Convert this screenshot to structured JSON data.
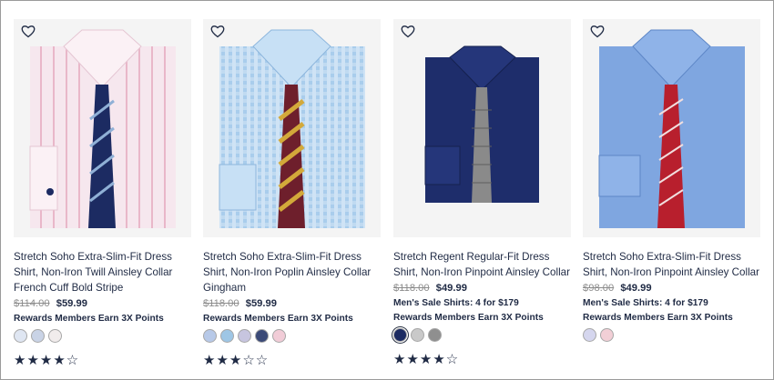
{
  "products": [
    {
      "title": "Stretch Soho Extra-Slim-Fit Dress Shirt, Non-Iron Twill Ainsley Collar French Cuff Bold Stripe",
      "original_price": "$114.00",
      "sale_price": "$59.99",
      "promo": "",
      "rewards": "Rewards Members Earn 3X Points",
      "swatches": [
        "#dfe6f2",
        "#c9d3e6",
        "#f1ecec"
      ],
      "rating_text": "★★★★☆",
      "shirt_color": "#f6e7ee",
      "stripe_color": "#e9b7c9",
      "tie_color": "#1c2b62",
      "tie_stripe": "#8fb0d6"
    },
    {
      "title": "Stretch Soho Extra-Slim-Fit Dress Shirt, Non-Iron Poplin Ainsley Collar Gingham",
      "original_price": "$118.00",
      "sale_price": "$59.99",
      "promo": "",
      "rewards": "Rewards Members Earn 3X Points",
      "swatches": [
        "#b7c9e8",
        "#9ec6e5",
        "#c7c5df",
        "#3b4a78",
        "#f1ccd7"
      ],
      "rating_text": "★★★☆☆",
      "shirt_color": "#a9cdec",
      "stripe_color": "#ffffff",
      "tie_color": "#6e1f2c",
      "tie_stripe": "#d3a93a"
    },
    {
      "title": "Stretch Regent Regular-Fit Dress Shirt, Non-Iron Pinpoint Ainsley Collar",
      "original_price": "$118.00",
      "sale_price": "$49.99",
      "promo": "Men's Sale Shirts: 4 for $179",
      "rewards": "Rewards Members Earn 3X Points",
      "swatches": [
        "#1c2b62",
        "#c9c9c9",
        "#8f8f8f"
      ],
      "rating_text": "★★★★☆",
      "shirt_color": "#1e2d6b",
      "stripe_color": "#1e2d6b",
      "tie_color": "#8a8a8a",
      "tie_stripe": "#5d5d5d"
    },
    {
      "title": "Stretch Soho Extra-Slim-Fit Dress Shirt, Non-Iron Pinpoint Ainsley Collar",
      "original_price": "$98.00",
      "sale_price": "$49.99",
      "promo": "Men's Sale Shirts: 4 for $179",
      "rewards": "Rewards Members Earn 3X Points",
      "swatches": [
        "#d5d6ee",
        "#f2cfd6"
      ],
      "rating_text": "",
      "shirt_color": "#7fa6e0",
      "stripe_color": "#7fa6e0",
      "tie_color": "#b81f2d",
      "tie_stripe": "#f1dede"
    }
  ],
  "icons": {
    "favorite": "heart-outline-icon",
    "rating_full": "star-filled-icon",
    "rating_empty": "star-outline-icon"
  },
  "colors": {
    "text": "#1f2a44",
    "strike": "#8c8c8c",
    "image_bg": "#f4f4f4"
  }
}
